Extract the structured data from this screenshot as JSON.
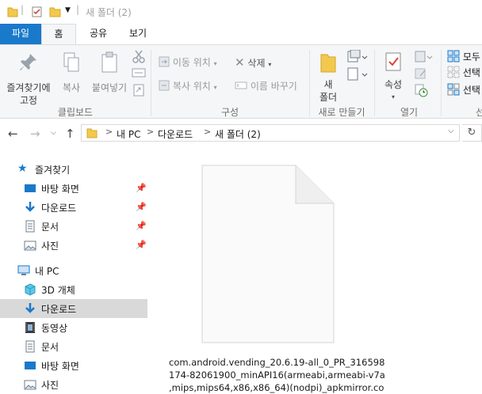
{
  "window": {
    "title": "새 폴더 (2)"
  },
  "ribbon_tabs": [
    {
      "label": "파일"
    },
    {
      "label": "홈"
    },
    {
      "label": "공유"
    },
    {
      "label": "보기"
    }
  ],
  "ribbon": {
    "clipboard": {
      "pin_label": "즐겨찾기에\n고정",
      "copy_label": "복사",
      "paste_label": "붙여넣기",
      "group_label": "클립보드"
    },
    "organize": {
      "move_to": "이동 위치",
      "copy_to": "복사 위치",
      "delete": "삭제",
      "rename": "이름 바꾸기",
      "group_label": "구성"
    },
    "new": {
      "new_folder_label": "새\n폴더",
      "group_label": "새로 만들기"
    },
    "open": {
      "properties_label": "속성",
      "group_label": "열기"
    },
    "select": {
      "select_all": "모두",
      "select_none": "선택",
      "invert_selection": "선택",
      "group_label": "선"
    }
  },
  "address": {
    "crumbs": [
      "내 PC",
      "다운로드",
      "새 폴더 (2)"
    ],
    "sep": ">"
  },
  "sidebar": {
    "quick_access": {
      "label": "즐겨찾기"
    },
    "quick_items": [
      {
        "label": "바탕 화면",
        "icon": "desktop-icon"
      },
      {
        "label": "다운로드",
        "icon": "download-icon"
      },
      {
        "label": "문서",
        "icon": "document-icon"
      },
      {
        "label": "사진",
        "icon": "pictures-icon"
      }
    ],
    "this_pc": {
      "label": "내 PC"
    },
    "pc_items": [
      {
        "label": "3D 개체",
        "icon": "3d-objects-icon"
      },
      {
        "label": "다운로드",
        "icon": "download-icon",
        "selected": true
      },
      {
        "label": "동영상",
        "icon": "videos-icon"
      },
      {
        "label": "문서",
        "icon": "document-icon"
      },
      {
        "label": "바탕 화면",
        "icon": "desktop-icon"
      },
      {
        "label": "사진",
        "icon": "pictures-icon"
      }
    ]
  },
  "files": [
    {
      "name_line1": "com.android.vending_20.6.19-all_0_PR_316598",
      "name_line2": "174-82061900_minAPI16(armeabi,armeabi-v7a",
      "name_line3": ",mips,mips64,x86,x86_64)(nodpi)_apkmirror.co",
      "icon": "generic-file-icon"
    }
  ],
  "colors": {
    "file_tab": "#1979ca",
    "selection": "#d9d9d9",
    "ribbon_bg": "#f5f6f7"
  }
}
